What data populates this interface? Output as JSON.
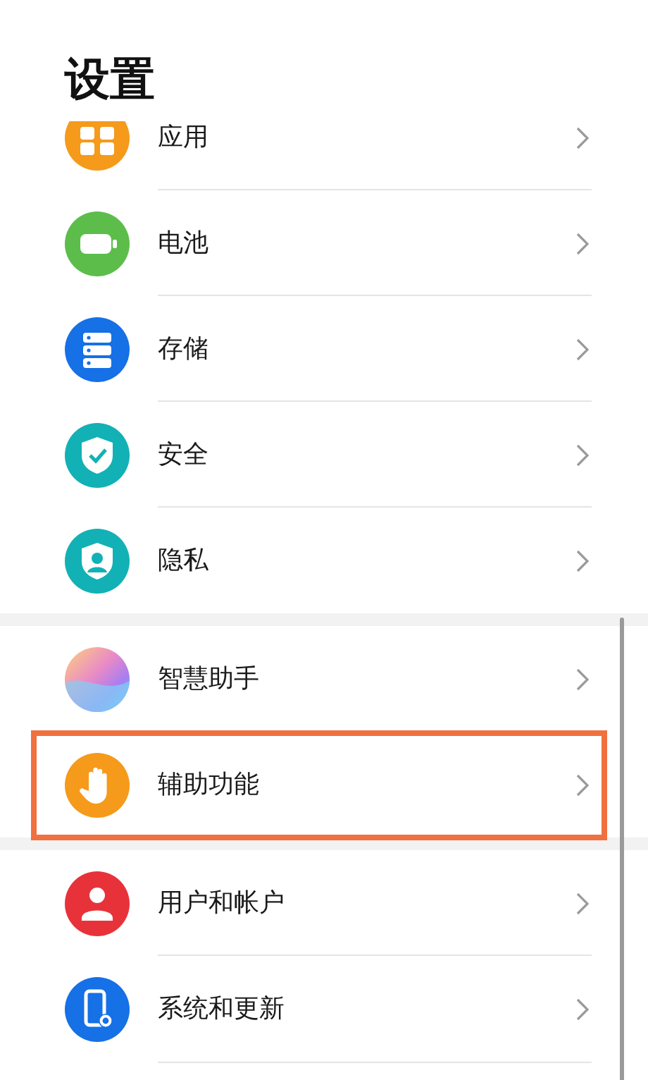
{
  "title": "设置",
  "groups": [
    {
      "items": [
        {
          "label": "应用",
          "highlighted": false
        },
        {
          "label": "电池",
          "highlighted": false
        },
        {
          "label": "存储",
          "highlighted": false
        },
        {
          "label": "安全",
          "highlighted": false
        },
        {
          "label": "隐私",
          "highlighted": false
        }
      ]
    },
    {
      "items": [
        {
          "label": "智慧助手",
          "highlighted": false
        },
        {
          "label": "辅助功能",
          "highlighted": true
        }
      ]
    },
    {
      "items": [
        {
          "label": "用户和帐户",
          "highlighted": false
        },
        {
          "label": "系统和更新",
          "highlighted": false
        }
      ]
    }
  ]
}
